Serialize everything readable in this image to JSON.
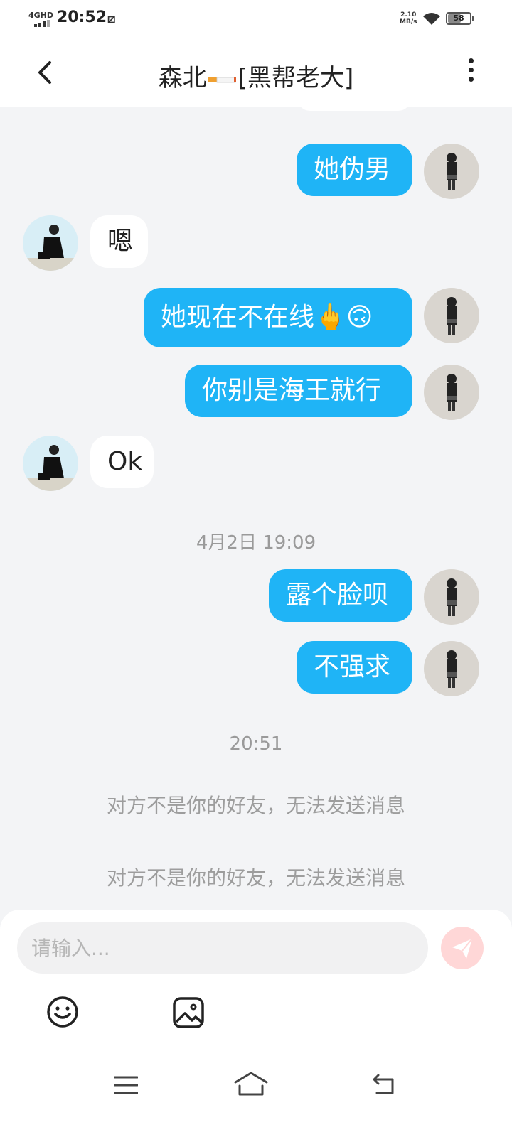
{
  "status_bar": {
    "network": "4GHD",
    "time": "20:52",
    "extra_icon": "⧄",
    "speed_value": "2.10",
    "speed_unit": "MB/s",
    "battery_level": "58"
  },
  "header": {
    "title_prefix": "森北",
    "title_suffix": "[黑帮老大]"
  },
  "messages": [
    {
      "side": "me",
      "text": "她伪男"
    },
    {
      "side": "them",
      "text": "嗯"
    },
    {
      "side": "me",
      "text": "她现在不在线🖕🙃"
    },
    {
      "side": "me",
      "text": "你别是海王就行"
    },
    {
      "side": "them",
      "text": "Ok"
    },
    {
      "side": "me",
      "text": "露个脸呗"
    },
    {
      "side": "me",
      "text": "不强求"
    }
  ],
  "timestamps": [
    "4月2日 19:09",
    "20:51"
  ],
  "system_messages": [
    "对方不是你的好友，无法发送消息",
    "对方不是你的好友，无法发送消息"
  ],
  "composer": {
    "placeholder": "请输入...",
    "value": ""
  },
  "colors": {
    "accent_bubble": "#1fb4f6",
    "background": "#f3f4f6",
    "send_button": "#ffd7d7"
  },
  "icons": {
    "back": "back-arrow-icon",
    "more": "more-vertical-icon",
    "send": "send-icon",
    "emoji": "emoji-icon",
    "image": "image-icon",
    "nav_menu": "nav-menu-icon",
    "nav_home": "nav-home-icon",
    "nav_back": "nav-back-icon"
  }
}
